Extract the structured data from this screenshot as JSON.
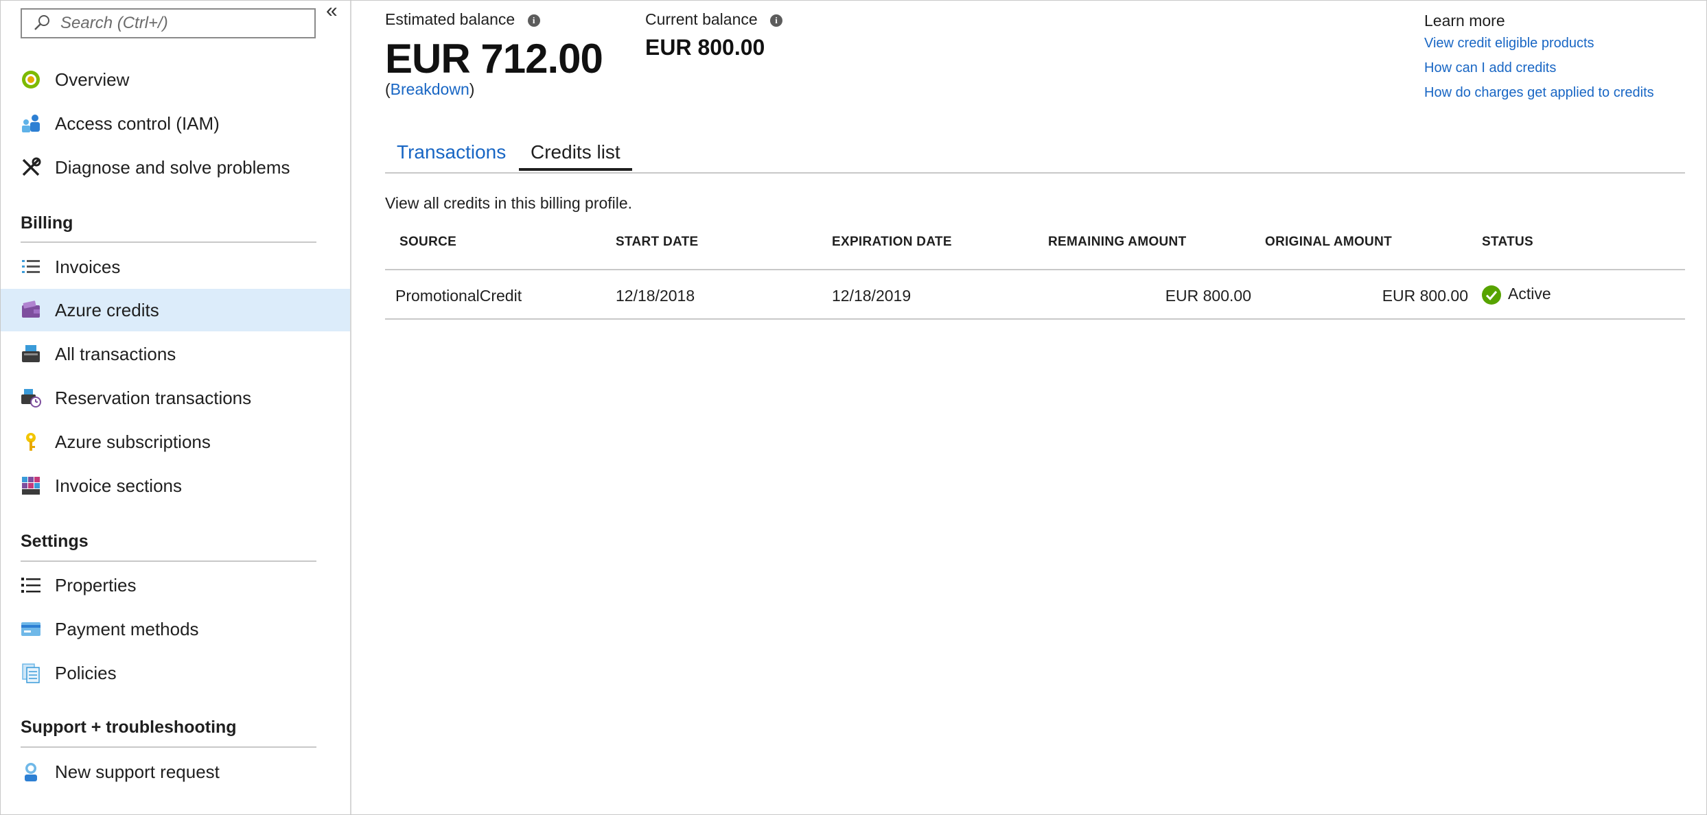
{
  "sidebar": {
    "search_placeholder": "Search (Ctrl+/)",
    "collapse_glyph": "«",
    "top_items": [
      {
        "label": "Overview",
        "icon": "overview-icon"
      },
      {
        "label": "Access control (IAM)",
        "icon": "iam-icon"
      },
      {
        "label": "Diagnose and solve problems",
        "icon": "tools-icon"
      }
    ],
    "sections": [
      {
        "title": "Billing",
        "items": [
          {
            "label": "Invoices",
            "icon": "list-icon"
          },
          {
            "label": "Azure credits",
            "icon": "wallet-icon",
            "active": true
          },
          {
            "label": "All transactions",
            "icon": "register-icon"
          },
          {
            "label": "Reservation transactions",
            "icon": "reservation-icon"
          },
          {
            "label": "Azure subscriptions",
            "icon": "key-icon"
          },
          {
            "label": "Invoice sections",
            "icon": "grid-icon"
          }
        ]
      },
      {
        "title": "Settings",
        "items": [
          {
            "label": "Properties",
            "icon": "properties-icon"
          },
          {
            "label": "Payment methods",
            "icon": "card-icon"
          },
          {
            "label": "Policies",
            "icon": "policies-icon"
          }
        ]
      },
      {
        "title": "Support + troubleshooting",
        "items": [
          {
            "label": "New support request",
            "icon": "support-icon"
          }
        ]
      }
    ]
  },
  "balance": {
    "estimated_label": "Estimated balance",
    "estimated_amount": "EUR 712.00",
    "breakdown_open": "(",
    "breakdown_link": "Breakdown",
    "breakdown_close": ")",
    "current_label": "Current balance",
    "current_amount": "EUR 800.00",
    "info_glyph": "i"
  },
  "learn_more": {
    "title": "Learn more",
    "links": [
      "View credit eligible products",
      "How can I add credits",
      "How do charges get applied to credits"
    ]
  },
  "tabs": [
    {
      "label": "Transactions",
      "active": false
    },
    {
      "label": "Credits list",
      "active": true
    }
  ],
  "credits": {
    "description": "View all credits in this billing profile.",
    "columns": [
      "SOURCE",
      "START DATE",
      "EXPIRATION DATE",
      "REMAINING AMOUNT",
      "ORIGINAL AMOUNT",
      "STATUS"
    ],
    "rows": [
      {
        "source": "PromotionalCredit",
        "start_date": "12/18/2018",
        "expiration_date": "12/18/2019",
        "remaining_amount": "EUR 800.00",
        "original_amount": "EUR 800.00",
        "status": "Active"
      }
    ]
  },
  "colors": {
    "link": "#1866c4",
    "active_nav_bg": "#dcecfa",
    "status_active": "#57a300"
  }
}
